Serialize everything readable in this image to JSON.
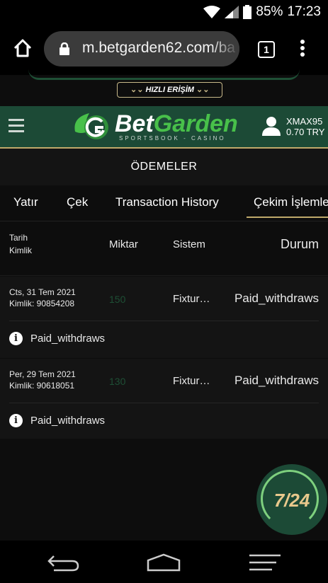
{
  "status_bar": {
    "battery": "85%",
    "time": "17:23"
  },
  "browser": {
    "url": "m.betgarden62.com/ba",
    "tab_count": "1"
  },
  "quick_access": {
    "label": "HIZLI ERİŞİM"
  },
  "header": {
    "brand_part1": "Bet",
    "brand_part2": "Garden",
    "brand_tagline": "SPORTSBOOK - CASINO",
    "username": "XMAX95",
    "balance": "0.70 TRY"
  },
  "section_title": "ÖDEMELER",
  "tabs": [
    {
      "label": "Yatır"
    },
    {
      "label": "Çek"
    },
    {
      "label": "Transaction History"
    },
    {
      "label": "Çekim İşlemleri"
    }
  ],
  "table": {
    "headers": {
      "date": "Tarih",
      "id": "Kimlik",
      "amount": "Miktar",
      "system": "Sistem",
      "status": "Durum"
    },
    "rows": [
      {
        "date": "Cts, 31 Tem 2021",
        "id": "Kimlik: 90854208",
        "amount": "150",
        "system": "Fixtur…",
        "status": "Paid_withdraws",
        "note": "Paid_withdraws"
      },
      {
        "date": "Per, 29 Tem 2021",
        "id": "Kimlik: 90618051",
        "amount": "130",
        "system": "Fixtur…",
        "status": "Paid_withdraws",
        "note": "Paid_withdraws"
      }
    ]
  },
  "support": {
    "label": "7/24"
  },
  "colors": {
    "brand_green": "#1c4a36",
    "gold": "#bfa96a",
    "logo_green": "#48c04a"
  }
}
